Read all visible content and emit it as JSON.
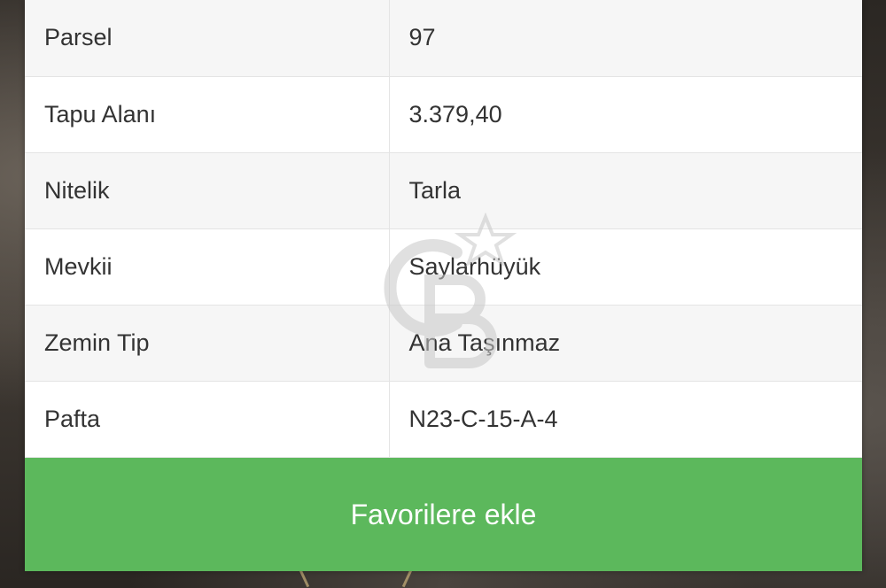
{
  "details": {
    "rows": [
      {
        "label": "Parsel",
        "value": "97"
      },
      {
        "label": "Tapu Alanı",
        "value": "3.379,40"
      },
      {
        "label": "Nitelik",
        "value": "Tarla"
      },
      {
        "label": "Mevkii",
        "value": "Saylarhüyük"
      },
      {
        "label": "Zemin Tip",
        "value": "Ana Taşınmaz"
      },
      {
        "label": "Pafta",
        "value": "N23-C-15-A-4"
      }
    ]
  },
  "actions": {
    "favorite_label": "Favorilere ekle"
  },
  "colors": {
    "button_green": "#5cb85c",
    "row_alt": "#f6f6f6",
    "text": "#333333"
  },
  "icons": {
    "watermark": "cb-star-logo-watermark"
  }
}
